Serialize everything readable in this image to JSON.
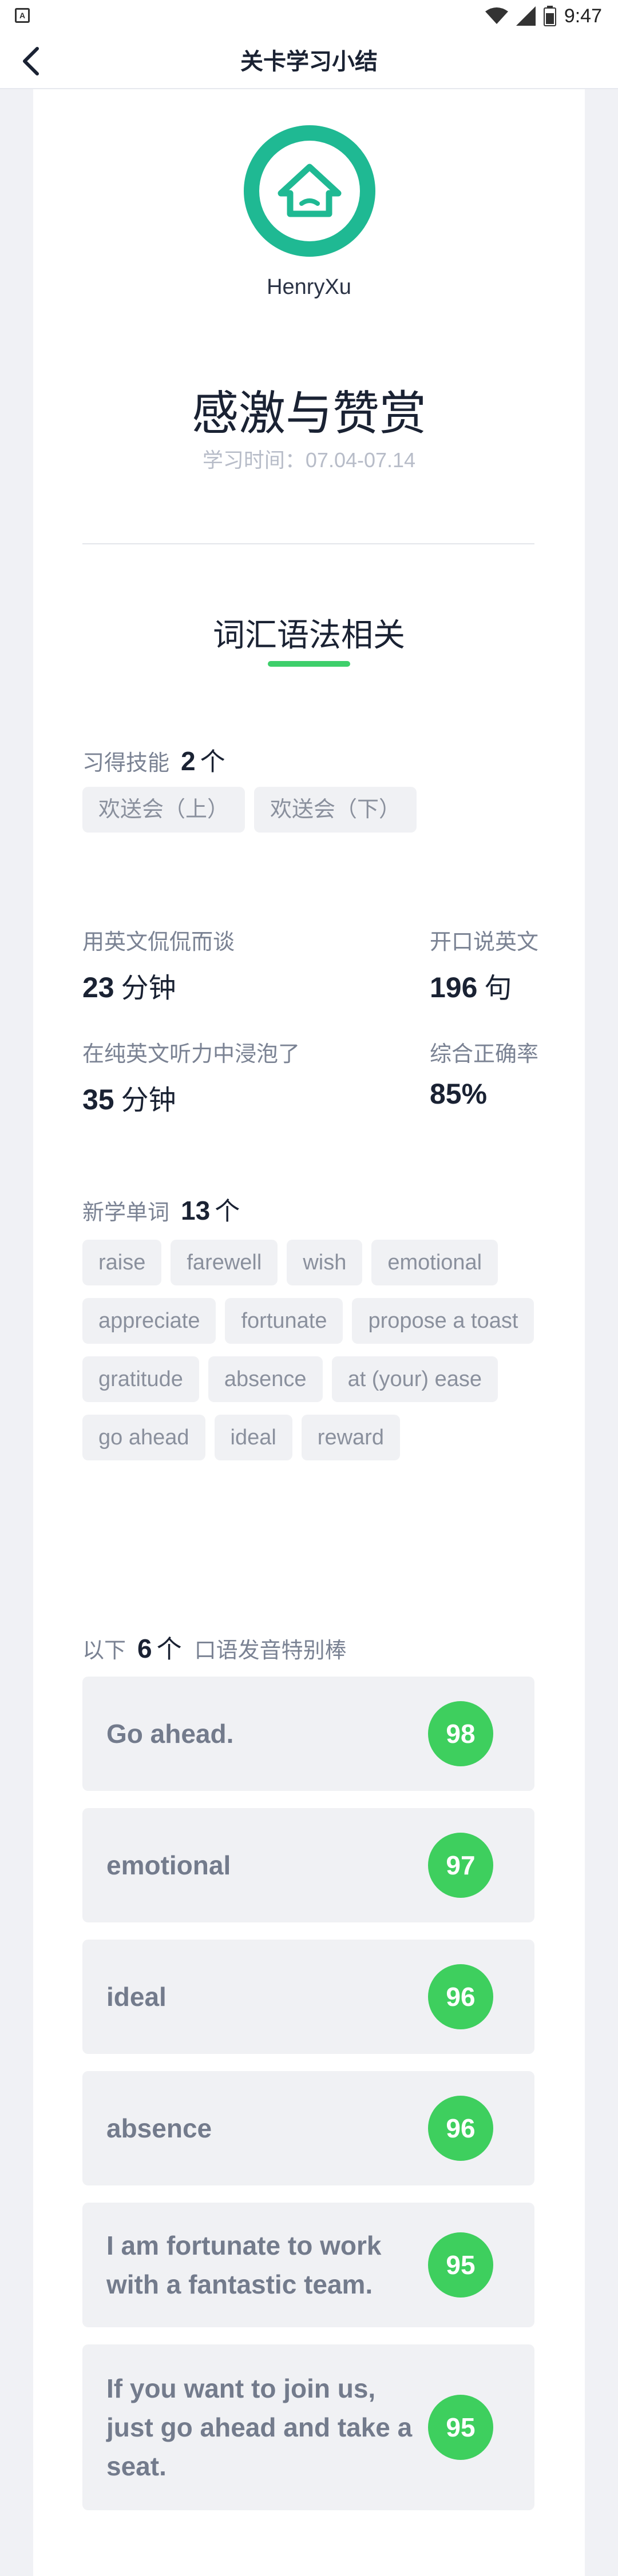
{
  "status_bar": {
    "app_icon": "A",
    "time": "9:47",
    "icons": [
      "wifi-icon",
      "signal-icon",
      "battery-icon"
    ]
  },
  "header": {
    "title": "关卡学习小结",
    "back_icon": "chevron-left-icon"
  },
  "profile": {
    "avatar_icon": "home-icon",
    "avatar_color": "#1fb993",
    "username": "HenryXu"
  },
  "lesson": {
    "title": "感激与赞赏",
    "study_time": "学习时间：07.04-07.14"
  },
  "section": {
    "heading": "词汇语法相关",
    "accent_color": "#3ecf6b"
  },
  "skills": {
    "label": "习得技能",
    "count": "2",
    "unit": "个",
    "items": [
      "欢送会（上）",
      "欢送会（下）"
    ]
  },
  "stats": {
    "chat_label": "用英文侃侃而谈",
    "chat_value": "23",
    "chat_unit": "分钟",
    "speak_label": "开口说英文",
    "speak_value": "196",
    "speak_unit": "句",
    "listen_label": "在纯英文听力中浸泡了",
    "listen_value": "35",
    "listen_unit": "分钟",
    "accuracy_label": "综合正确率",
    "accuracy_value": "85%"
  },
  "new_words": {
    "label": "新学单词",
    "count": "13",
    "unit": "个",
    "items": [
      "raise",
      "farewell",
      "wish",
      "emotional",
      "appreciate",
      "fortunate",
      "propose a toast",
      "gratitude",
      "absence",
      "at (your) ease",
      "go ahead",
      "ideal",
      "reward"
    ]
  },
  "pronunciation": {
    "prefix": "以下",
    "count": "6",
    "unit": "个",
    "suffix": "口语发音特别棒",
    "badge_color": "#3ecf5e",
    "items": [
      {
        "text": "Go ahead.",
        "score": "98"
      },
      {
        "text": "emotional",
        "score": "97"
      },
      {
        "text": "ideal",
        "score": "96"
      },
      {
        "text": "absence",
        "score": "96"
      },
      {
        "text": "I am fortunate to work with a fantastic team.",
        "score": "95"
      },
      {
        "text": "If you want to join us, just go ahead and take a seat.",
        "score": "95"
      }
    ]
  }
}
